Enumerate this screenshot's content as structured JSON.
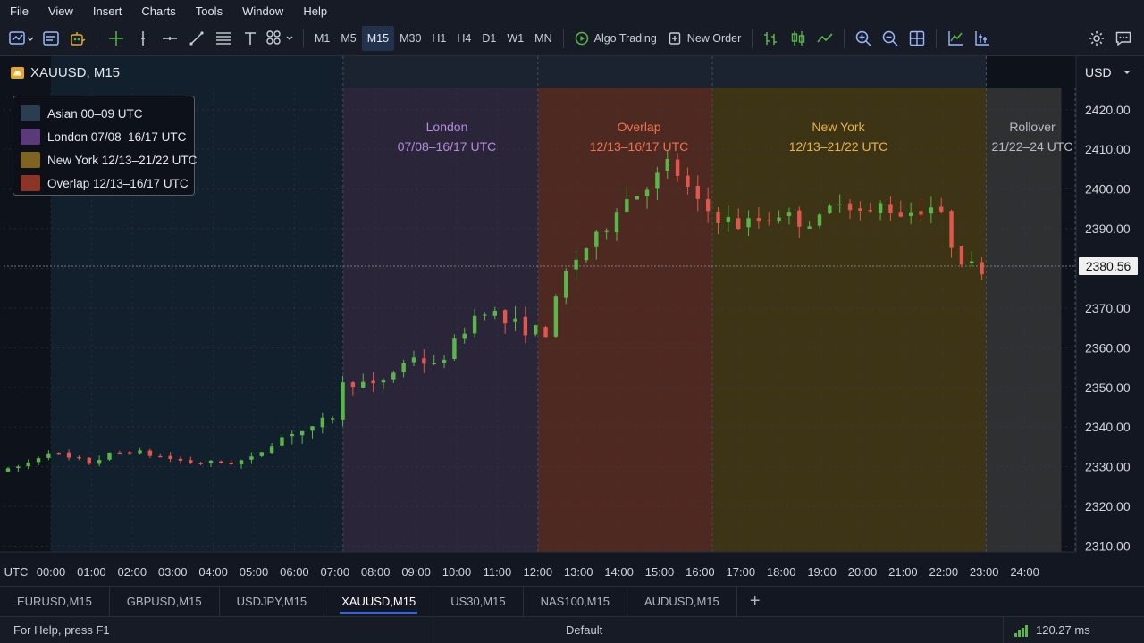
{
  "menu": [
    "File",
    "View",
    "Insert",
    "Charts",
    "Tools",
    "Window",
    "Help"
  ],
  "toolbar": {
    "timeframes": [
      "M1",
      "M5",
      "M15",
      "M30",
      "H1",
      "H4",
      "D1",
      "W1",
      "MN"
    ],
    "active_timeframe": "M15",
    "algo_trading": "Algo Trading",
    "new_order": "New Order"
  },
  "chart": {
    "symbol_title": "XAUUSD, M15",
    "currency": "USD",
    "current_price": "2380.56",
    "time_axis_label": "UTC"
  },
  "sessions": {
    "london": {
      "name": "London",
      "hours": "07/08–16/17 UTC"
    },
    "overlap": {
      "name": "Overlap",
      "hours": "12/13–16/17 UTC"
    },
    "newyork": {
      "name": "New York",
      "hours": "12/13–21/22 UTC"
    },
    "rollover": {
      "name": "Rollover",
      "hours": "21/22–24 UTC"
    }
  },
  "legend": [
    {
      "label": "Asian 00–09 UTC",
      "color": "#2b3d50"
    },
    {
      "label": "London 07/08–16/17 UTC",
      "color": "#5a3a78"
    },
    {
      "label": "New York 12/13–21/22 UTC",
      "color": "#7e6420"
    },
    {
      "label": "Overlap 12/13–16/17 UTC",
      "color": "#8b3526"
    }
  ],
  "colors": {
    "bull": "#5bb64a",
    "bear": "#e2574c",
    "london_text": "#b48ce0",
    "overlap_text": "#f0734e",
    "newyork_text": "#e8b24a",
    "rollover_text": "#b9bcc4"
  },
  "tabs": [
    "EURUSD,M15",
    "GBPUSD,M15",
    "USDJPY,M15",
    "XAUUSD,M15",
    "US30,M15",
    "NAS100,M15",
    "AUDUSD,M15"
  ],
  "active_tab": "XAUUSD,M15",
  "status": {
    "help": "For Help, press F1",
    "profile": "Default",
    "ping": "120.27 ms"
  },
  "chart_data": {
    "type": "candlestick",
    "x_axis_unit": "UTC",
    "x_ticks": [
      "00:00",
      "01:00",
      "02:00",
      "03:00",
      "04:00",
      "05:00",
      "06:00",
      "07:00",
      "08:00",
      "09:00",
      "10:00",
      "11:00",
      "12:00",
      "13:00",
      "14:00",
      "15:00",
      "16:00",
      "17:00",
      "18:00",
      "19:00",
      "20:00",
      "21:00",
      "22:00",
      "23:00",
      "24:00"
    ],
    "y_ticks": [
      2310,
      2320,
      2330,
      2340,
      2350,
      2360,
      2370,
      2380,
      2390,
      2400,
      2410,
      2420
    ],
    "ylim": [
      2308,
      2428
    ],
    "current_price": 2380.56,
    "sessions": [
      {
        "name": "Asian",
        "start": 0,
        "end": 7.2
      },
      {
        "name": "London",
        "start": 7.2,
        "end": 12
      },
      {
        "name": "Overlap",
        "start": 12,
        "end": 16.3
      },
      {
        "name": "New York",
        "start": 16.3,
        "end": 23.05
      },
      {
        "name": "Rollover",
        "start": 23.05,
        "end": 24.9
      }
    ],
    "close_path": [
      [
        0,
        2329
      ],
      [
        0.5,
        2331
      ],
      [
        1.0,
        2334
      ],
      [
        1.5,
        2332
      ],
      [
        2.0,
        2331
      ],
      [
        2.5,
        2333
      ],
      [
        3.0,
        2334
      ],
      [
        3.5,
        2333
      ],
      [
        4.0,
        2332
      ],
      [
        4.5,
        2331
      ],
      [
        5.0,
        2331
      ],
      [
        5.5,
        2331
      ],
      [
        6.0,
        2332
      ],
      [
        6.5,
        2336
      ],
      [
        7.0,
        2339
      ],
      [
        7.5,
        2339
      ],
      [
        8.0,
        2343
      ],
      [
        8.3,
        2352
      ],
      [
        8.7,
        2351
      ],
      [
        9.0,
        2350
      ],
      [
        9.5,
        2354
      ],
      [
        10.0,
        2358
      ],
      [
        10.5,
        2355
      ],
      [
        11.0,
        2361
      ],
      [
        11.5,
        2368
      ],
      [
        11.8,
        2370
      ],
      [
        12.3,
        2366
      ],
      [
        12.8,
        2365
      ],
      [
        13.2,
        2363
      ],
      [
        13.5,
        2371
      ],
      [
        13.8,
        2380
      ],
      [
        14.2,
        2385
      ],
      [
        14.6,
        2388
      ],
      [
        15.0,
        2396
      ],
      [
        15.5,
        2399
      ],
      [
        15.8,
        2402
      ],
      [
        16.0,
        2403
      ],
      [
        16.3,
        2407
      ],
      [
        16.6,
        2402
      ],
      [
        17.0,
        2396
      ],
      [
        17.5,
        2393
      ],
      [
        18.0,
        2391
      ],
      [
        18.5,
        2392
      ],
      [
        19.0,
        2394
      ],
      [
        19.5,
        2392
      ],
      [
        20.0,
        2392
      ],
      [
        20.5,
        2398
      ],
      [
        20.9,
        2395
      ],
      [
        21.2,
        2393
      ],
      [
        21.5,
        2396
      ],
      [
        22.0,
        2394
      ],
      [
        22.5,
        2395
      ],
      [
        22.9,
        2396
      ],
      [
        23.1,
        2390
      ],
      [
        23.3,
        2385
      ],
      [
        23.6,
        2381
      ],
      [
        24.0,
        2380
      ]
    ]
  }
}
